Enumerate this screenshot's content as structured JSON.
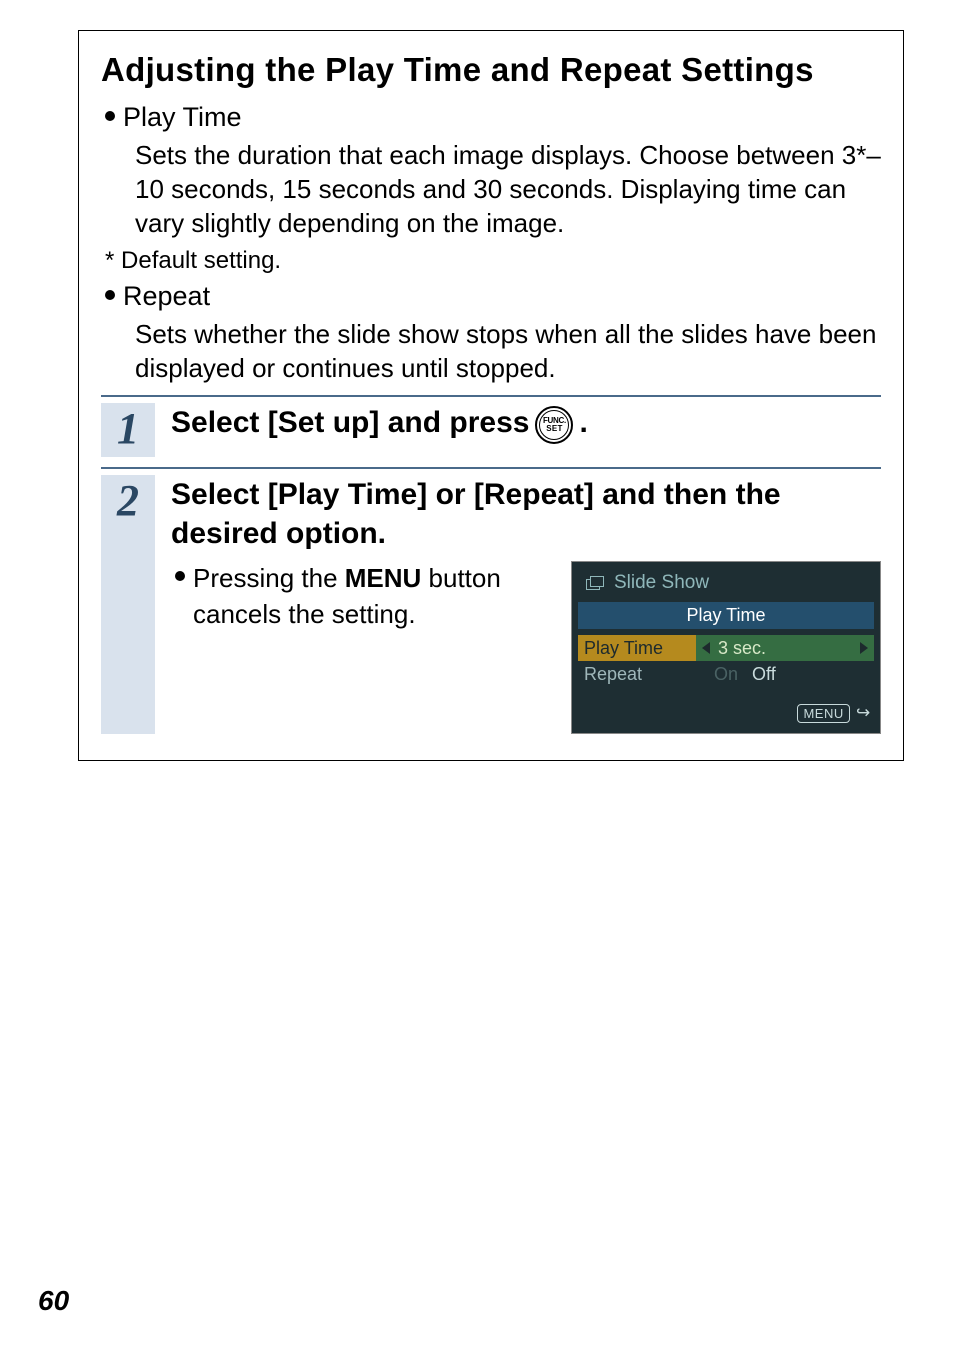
{
  "main_title": "Adjusting the Play Time and Repeat Settings",
  "bullets": {
    "play_time": {
      "label": "Play Time",
      "desc": "Sets the duration that each image displays. Choose between 3*–10 seconds, 15 seconds and 30 seconds. Displaying time can vary slightly depending on the image."
    },
    "footnote": "*  Default setting.",
    "repeat": {
      "label": "Repeat",
      "desc": "Sets whether the slide show stops when all the slides have been displayed or continues until stopped."
    }
  },
  "steps": {
    "s1": {
      "num": "1",
      "text_a": "Select [Set up] and press",
      "text_b": "."
    },
    "s2": {
      "num": "2",
      "heading": "Select [Play Time] or [Repeat] and then the desired option.",
      "sub_a": "Pressing the ",
      "sub_bold": "MENU",
      "sub_b": " button cancels the setting."
    }
  },
  "func_icon": {
    "top": "FUNC.",
    "bot": "SET"
  },
  "lcd": {
    "title": "Slide Show",
    "section": "Play Time",
    "row1_label": "Play Time",
    "row1_value": "3 sec.",
    "row2_label": "Repeat",
    "row2_on": "On",
    "row2_off": "Off",
    "footer_menu": "MENU"
  },
  "page_number": "60"
}
